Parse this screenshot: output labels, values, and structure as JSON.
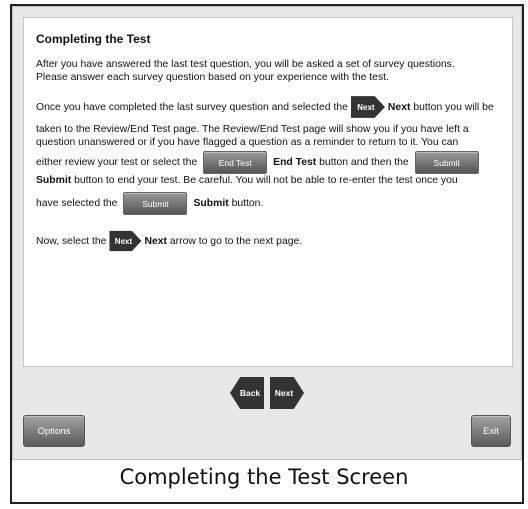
{
  "content": {
    "title": "Completing the Test",
    "p1_line1": "After you have answered the last test question, you will be asked a set of survey questions.",
    "p1_line2": "Please answer each survey question based on your experience with the test.",
    "p2_pre": "Once you have completed the last survey question and selected the",
    "next_word": "Next",
    "p2_post": "button you will be",
    "p2_line2": "taken to the Review/End Test page. The Review/End Test page will show you if you have left a",
    "p2_line3": "question unanswered or if you have flagged a question as a reminder to return to it. You can",
    "p2_line4_pre": "either review your test or select the",
    "end_test_word": "End Test",
    "p2_line4_mid": "button and then the",
    "submit_word": "Submit",
    "p2_line5_post": "button to end your test. Be careful. You will not be able to re-enter the test once you",
    "p2_line6_pre": "have selected the",
    "p2_line6_post": "button.",
    "p3_pre": "Now, select the",
    "p3_post": "arrow to go to the next page."
  },
  "icons": {
    "next_icon_label": "Next",
    "end_test_icon_label": "End Test",
    "submit_icon_label": "Submit"
  },
  "nav": {
    "back_label": "Back",
    "next_label": "Next"
  },
  "footer": {
    "options_label": "Options",
    "exit_label": "Exit"
  },
  "caption": "Completing the Test Screen"
}
